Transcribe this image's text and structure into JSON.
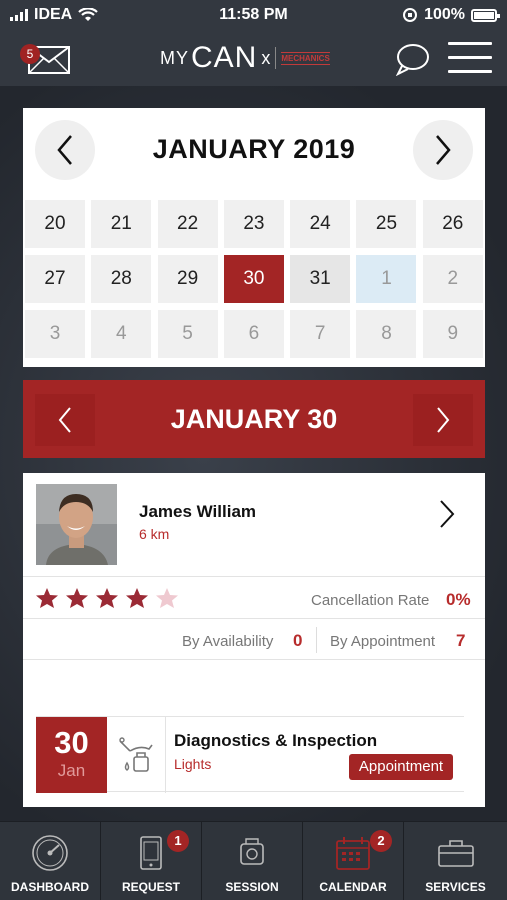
{
  "status_bar": {
    "carrier": "IDEA",
    "time": "11:58 PM",
    "battery": "100%"
  },
  "header": {
    "mail_badge": "5",
    "logo_my": "MY",
    "logo_can": "CAN",
    "logo_x": "x",
    "logo_brand_line1": "MECHANICS",
    "logo_brand_line2": "————"
  },
  "calendar": {
    "title": "JANUARY 2019",
    "weeks": [
      [
        {
          "d": "20"
        },
        {
          "d": "21"
        },
        {
          "d": "22"
        },
        {
          "d": "23"
        },
        {
          "d": "24"
        },
        {
          "d": "25"
        },
        {
          "d": "26"
        }
      ],
      [
        {
          "d": "27"
        },
        {
          "d": "28"
        },
        {
          "d": "29"
        },
        {
          "d": "30",
          "state": "selected"
        },
        {
          "d": "31",
          "state": "light"
        },
        {
          "d": "1",
          "state": "today"
        },
        {
          "d": "2",
          "state": "dim"
        }
      ],
      [
        {
          "d": "3",
          "state": "dim"
        },
        {
          "d": "4",
          "state": "dim"
        },
        {
          "d": "5",
          "state": "dim"
        },
        {
          "d": "6",
          "state": "dim"
        },
        {
          "d": "7",
          "state": "dim"
        },
        {
          "d": "8",
          "state": "dim"
        },
        {
          "d": "9",
          "state": "dim"
        }
      ]
    ]
  },
  "date_bar": {
    "title": "JANUARY 30"
  },
  "profile": {
    "name": "James William",
    "distance": "6 km",
    "rating": 4,
    "rating_max": 5,
    "cancellation_label": "Cancellation Rate",
    "cancellation_value": "0%",
    "availability_label": "By Availability",
    "availability_value": "0",
    "appointment_label": "By Appointment",
    "appointment_value": "7"
  },
  "appointment": {
    "day": "30",
    "month": "Jan",
    "title": "Diagnostics & Inspection",
    "subtitle": "Lights",
    "badge": "Appointment"
  },
  "tabs": [
    {
      "label": "DASHBOARD",
      "icon": "speedometer-icon",
      "badge": ""
    },
    {
      "label": "REQUEST",
      "icon": "phone-request-icon",
      "badge": "1"
    },
    {
      "label": "SESSION",
      "icon": "engine-icon",
      "badge": ""
    },
    {
      "label": "CALENDAR",
      "icon": "calendar-icon",
      "badge": "2",
      "active": true
    },
    {
      "label": "SERVICES",
      "icon": "toolbox-icon",
      "badge": ""
    }
  ],
  "colors": {
    "accent": "#a32525",
    "header": "#333840",
    "tabbar": "#2f343b"
  }
}
